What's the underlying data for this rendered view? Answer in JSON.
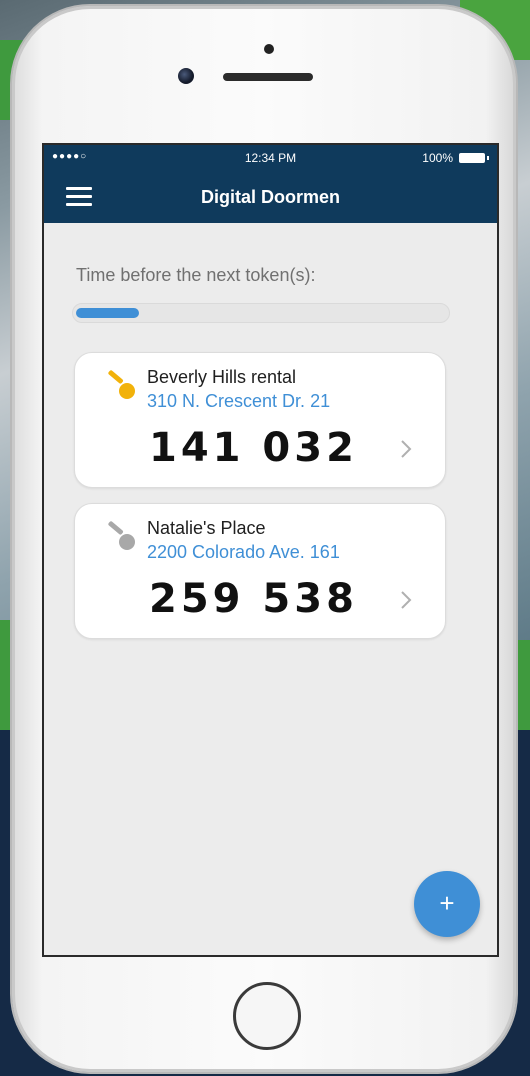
{
  "status_bar": {
    "signal": "●●●●○",
    "time": "12:34 PM",
    "battery": "100%"
  },
  "app_bar": {
    "title": "Digital Doormen",
    "menu_icon": "hamburger-icon"
  },
  "timer": {
    "label": "Time before the next token(s):",
    "progress_fraction": 0.17
  },
  "tokens": [
    {
      "name": "Beverly Hills rental",
      "address": "310 N. Crescent Dr. 21",
      "code": "141 032",
      "key_icon": "key-icon",
      "key_color": "#f2b20a",
      "active": true
    },
    {
      "name": "Natalie's Place",
      "address": "2200 Colorado Ave. 161",
      "code": "259 538",
      "key_icon": "key-icon",
      "key_color": "#a8a8a8",
      "active": false
    }
  ],
  "fab": {
    "label": "+",
    "icon": "plus-icon"
  },
  "colors": {
    "app_bar": "#0f3a5c",
    "accent": "#3f8fd6"
  }
}
